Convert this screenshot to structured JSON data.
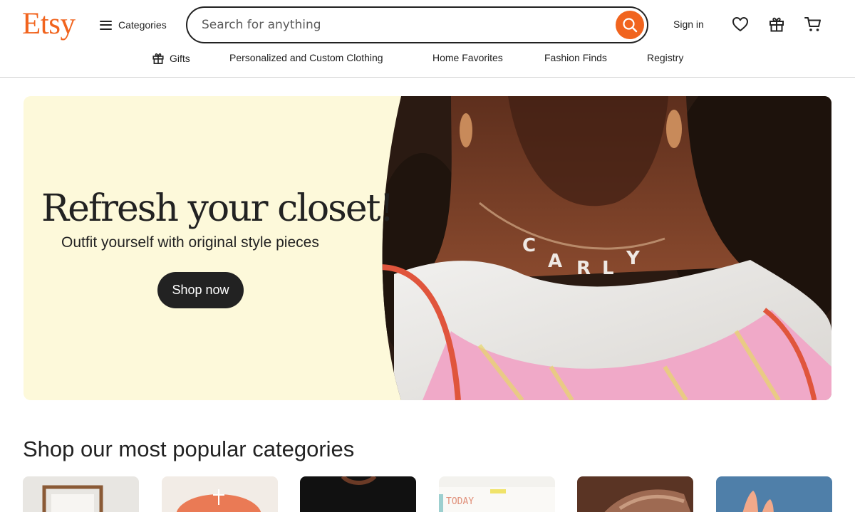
{
  "brand": {
    "logo": "Etsy",
    "accent": "#f1641e"
  },
  "header": {
    "categories_label": "Categories",
    "search_placeholder": "Search for anything",
    "search_value": "",
    "signin_label": "Sign in",
    "icons": [
      "heart-icon",
      "gift-icon",
      "cart-icon"
    ]
  },
  "subnav": {
    "items": [
      {
        "label": "Gifts",
        "icon": "gift-icon"
      },
      {
        "label": "Personalized and Custom Clothing"
      },
      {
        "label": "Home Favorites"
      },
      {
        "label": "Fashion Finds"
      },
      {
        "label": "Registry"
      }
    ]
  },
  "hero": {
    "title": "Refresh your closet!",
    "subtitle": "Outfit yourself with original style pieces",
    "cta": "Shop now",
    "necklace_text": "CARLY",
    "bg_color": "#fdf9da"
  },
  "categories_section": {
    "title": "Shop our most popular categories",
    "cards": [
      {
        "name": "frame",
        "caption": ""
      },
      {
        "name": "embroidery",
        "caption": ""
      },
      {
        "name": "black-shirt",
        "caption": ""
      },
      {
        "name": "planner",
        "caption": "TODAY"
      },
      {
        "name": "hand-jewelry",
        "caption": ""
      },
      {
        "name": "hand-blue",
        "caption": ""
      }
    ]
  }
}
